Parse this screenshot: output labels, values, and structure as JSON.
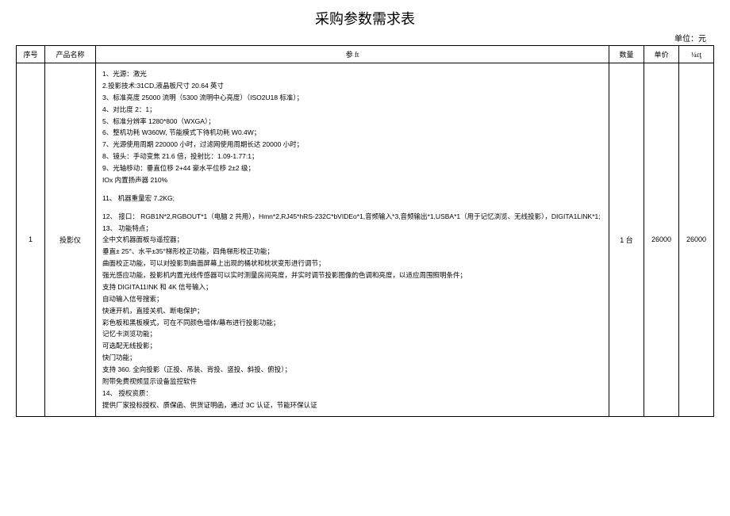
{
  "title": "采购参数需求表",
  "unit_label": "单位：元",
  "headers": {
    "seq": "序号",
    "name": "产品名称",
    "param": "参 ft",
    "qty": "数量",
    "price": "单价",
    "total": "¼ɛţ"
  },
  "rows": [
    {
      "seq": "1",
      "name": "投影仪",
      "qty": "1 台",
      "price": "26000",
      "total": "26000",
      "param_lines": [
        "1、光源：激光",
        "2.投影技术:31CD,液晶板尺寸 20.64 英寸",
        "3、标准亮度 25000 流明（5300 流明中心亮度）（ISO2U18 标准）；",
        "4、对比度 2：1；",
        "5、标准分辨率 1280*800（WXGA）；",
        "6、整机功耗 W360W, 节能模式下待机功耗 W0.4W；",
        "7、光源使用周期 220000 小时，过滤网使用周期长达 20000 小时；",
        "8、镜头：手动变焦 21.6 倍，投射比：1.09-1.77:1；",
        "9、光轴移动：垂直位移 2+44 豪水平位移 2±2 级；",
        "IOx 内置扬声器 210%",
        "",
        "11、 机器重量宏 7.2KG;",
        "",
        "12、 接口： RGB1N*2,RGBOUT*1（电脑 2 共用），Hmn*2,RJ45*hRS-232C*bVIDEo*1,音频输入*3,音频输出*1,USBA*1（用于记忆浏览、无线投影），DIGITA1LINK*1;",
        "13、 功能特点；",
        "全中文机器面板与遥控器；",
        "垂直± 25°、水平±35°梯形校正功能，四角梯形校正功能；",
        "曲面校正功能，可以对投影到曲面屏幕上出现的桶状和枕状变形进行调节；",
        "强光感应功能，投影机内置光线传感器可以实时测量房间亮度，并实时调节投影图像的色调和亮度，以适应周围照明条件；",
        "支持 DIGITA11INK 和 4K 信号输入；",
        "自动输入信号搜索；",
        "快速开机，直接关机、断电保护；",
        "彩色板和黑板模式，可在不同颜色墙体/幕布进行投影功能；",
        "记忆卡浏览功能；",
        "可选配无线投影；",
        "快门功能；",
        "支持 360. 全向投影（正投、吊装、背投、竖投、斜投、俯投）；",
        "附带免费视频显示设备监控软件",
        "14、 授权资质：",
        "提供厂家投标授权、质保函、供货证明函，通过 3C 认证，节能环保认证"
      ]
    }
  ]
}
